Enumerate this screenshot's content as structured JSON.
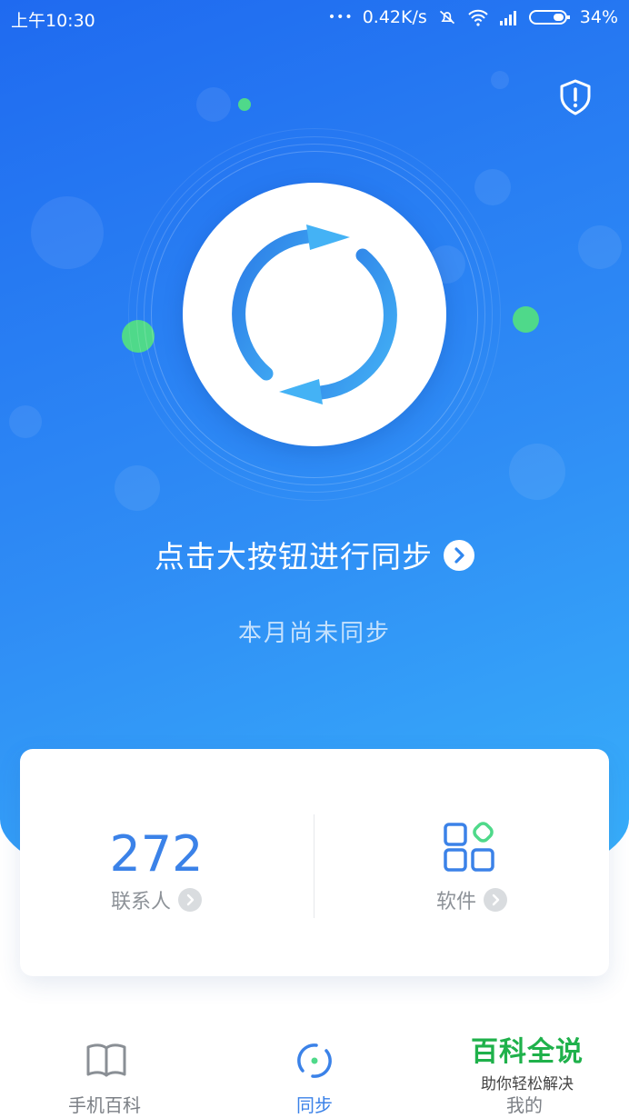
{
  "status_bar": {
    "time": "上午10:30",
    "dots": "•••",
    "network_speed": "0.42K/s",
    "battery": "34%",
    "icons": [
      "mute-bell-icon",
      "wifi-icon",
      "signal-icon",
      "battery-icon"
    ]
  },
  "header": {
    "shield_icon": "shield-alert-icon"
  },
  "sync": {
    "button_icon": "sync-arrows-icon",
    "cta_text": "点击大按钮进行同步",
    "cta_arrow_icon": "chevron-right-icon",
    "status_text": "本月尚未同步"
  },
  "stats": {
    "contacts": {
      "count": "272",
      "label": "联系人"
    },
    "apps": {
      "icon": "apps-grid-icon",
      "label": "软件"
    }
  },
  "nav": {
    "items": [
      {
        "label": "手机百科",
        "icon": "book-icon",
        "active": false
      },
      {
        "label": "同步",
        "icon": "sync-icon",
        "active": true
      },
      {
        "label": "我的",
        "icon": "person-icon",
        "active": false
      }
    ]
  },
  "watermark": {
    "title": "百科全说",
    "subtitle": "助你轻松解决"
  },
  "colors": {
    "primary": "#3b82e8",
    "hero_start": "#1f6af0",
    "hero_end": "#39b2fb",
    "accent_green": "#4fd98a",
    "watermark_green": "#1fb14b"
  }
}
